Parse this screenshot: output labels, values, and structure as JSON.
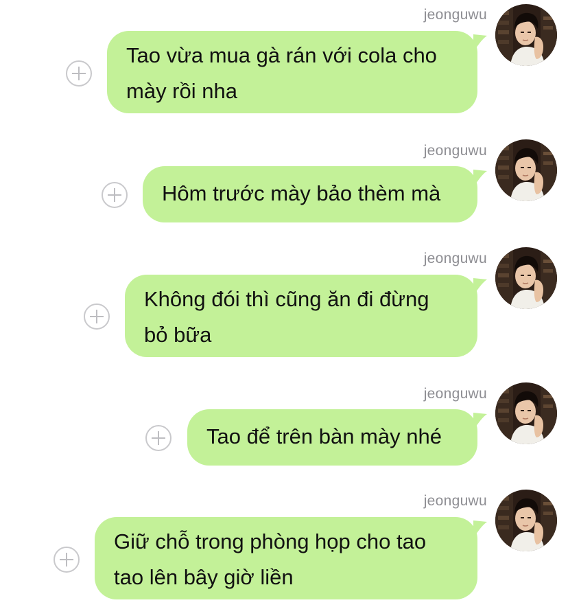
{
  "chat": {
    "messages": [
      {
        "sender": "jeonguwu",
        "text": "Tao vừa mua gà rán với cola cho mày rồi nha"
      },
      {
        "sender": "jeonguwu",
        "text": "Hôm trước mày bảo thèm mà"
      },
      {
        "sender": "jeonguwu",
        "text": "Không đói thì cũng ăn đi đừng bỏ bữa"
      },
      {
        "sender": "jeonguwu",
        "text": "Tao để trên bàn mày nhé"
      },
      {
        "sender": "jeonguwu",
        "text": "Giữ chỗ trong phòng họp cho tao tao lên bây giờ liền"
      }
    ]
  },
  "icons": {
    "add": "plus-circle-icon",
    "avatar": "user-avatar-photo"
  },
  "colors": {
    "bubble": "#c3f198",
    "sender_name": "#8e8e93",
    "background": "#ffffff",
    "plus_outline": "#c9c9cc"
  }
}
